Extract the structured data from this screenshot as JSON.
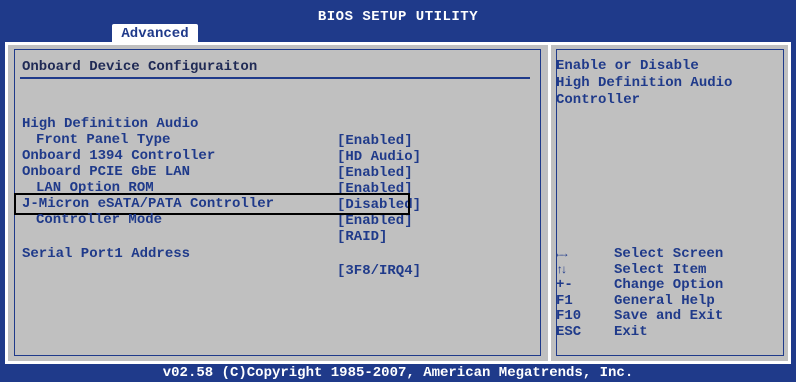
{
  "header": {
    "title": "BIOS SETUP UTILITY",
    "tab": "Advanced"
  },
  "section": {
    "title": "Onboard Device Configuraiton"
  },
  "settings": [
    {
      "label": "High Definition Audio",
      "value": "[Enabled]",
      "sub": false
    },
    {
      "label": "Front Panel Type",
      "value": "[HD Audio]",
      "sub": true
    },
    {
      "label": "Onboard 1394 Controller",
      "value": "[Enabled]",
      "sub": false
    },
    {
      "label": "Onboard PCIE GbE LAN",
      "value": "[Enabled]",
      "sub": false
    },
    {
      "label": "LAN Option ROM",
      "value": "[Disabled]",
      "sub": true
    },
    {
      "label": "J-Micron eSATA/PATA Controller",
      "value": "[Enabled]",
      "sub": false
    },
    {
      "label": "Controller Mode",
      "value": "[RAID]",
      "sub": true,
      "selected": true
    },
    {
      "label": "Serial Port1 Address",
      "value": "[3F8/IRQ4]",
      "sub": false
    }
  ],
  "help": {
    "lines": [
      "Enable or Disable",
      "High Definition Audio",
      "Controller"
    ]
  },
  "keys": [
    {
      "key": "←→",
      "desc": "Select Screen",
      "icon": "left-right-arrows-icon"
    },
    {
      "key": "↑↓",
      "desc": "Select Item",
      "icon": "up-down-arrows-icon"
    },
    {
      "key": "+-",
      "desc": "Change Option"
    },
    {
      "key": "F1",
      "desc": "General Help"
    },
    {
      "key": "F10",
      "desc": "Save and Exit"
    },
    {
      "key": "ESC",
      "desc": "Exit"
    }
  ],
  "footer": {
    "copyright": "v02.58 (C)Copyright 1985-2007, American Megatrends, Inc."
  },
  "colors": {
    "frame_blue": "#1f3a8a",
    "panel_grey": "#c0c0c0",
    "text_blue": "#1f3a8a",
    "white": "#ffffff"
  }
}
